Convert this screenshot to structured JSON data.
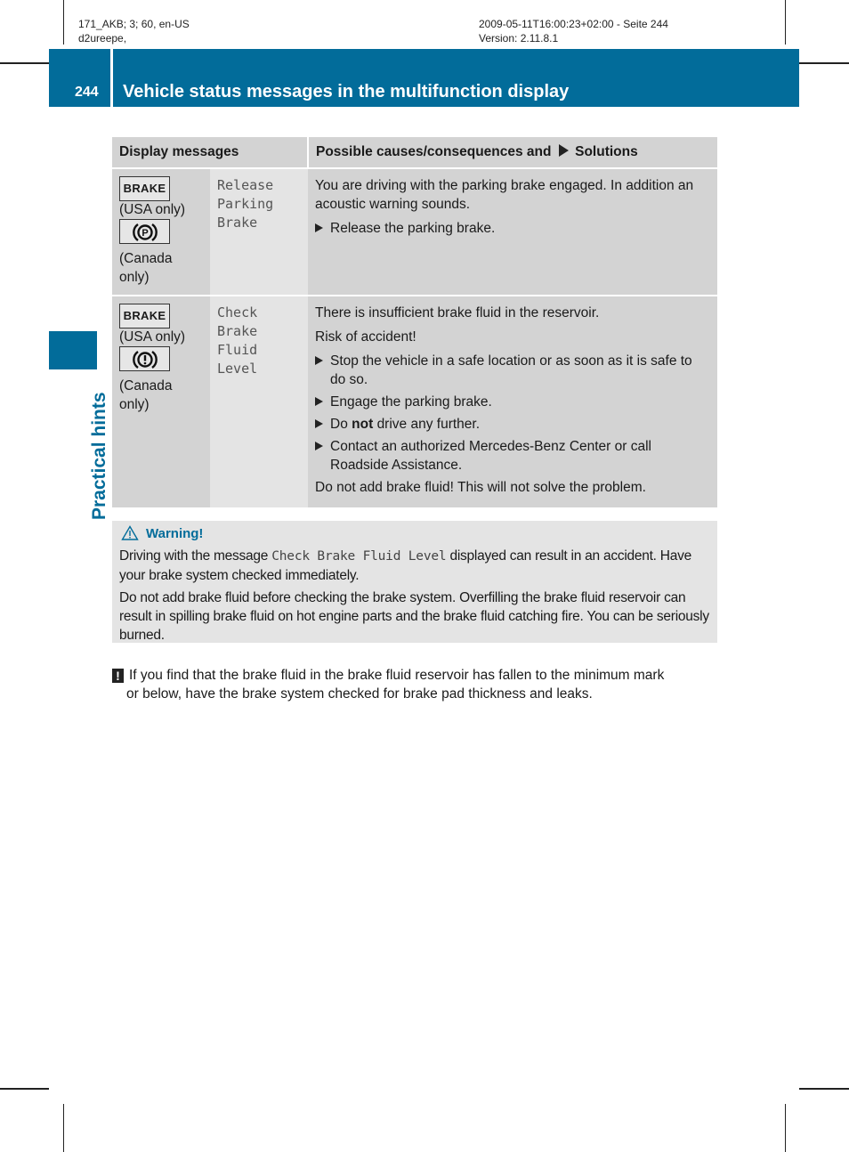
{
  "print_meta": {
    "left_line1": "171_AKB; 3; 60, en-US",
    "left_line2": "d2ureepe,",
    "right_line1": "2009-05-11T16:00:23+02:00 - Seite 244",
    "right_line2": "Version: 2.11.8.1"
  },
  "header": {
    "page_number": "244",
    "title": "Vehicle status messages in the multifunction display",
    "accent_color": "#026c9a"
  },
  "side_tab": {
    "label": "Practical hints"
  },
  "table": {
    "headers": {
      "display": "Display messages",
      "causes": "Possible causes/consequences and",
      "solutions": "Solutions"
    },
    "rows": [
      {
        "icon_usa_text": "BRAKE",
        "icon_usa_label": "(USA only)",
        "icon_canada": "parking-brake-icon",
        "icon_canada_label_1": "(Canada",
        "icon_canada_label_2": "only)",
        "display_lines": [
          "Release",
          "Parking",
          "Brake"
        ],
        "text_1": "You are driving with the parking brake engaged. In addition an acoustic warning sounds.",
        "steps": [
          "Release the parking brake."
        ]
      },
      {
        "icon_usa_text": "BRAKE",
        "icon_usa_label": "(USA only)",
        "icon_canada": "brake-warning-icon",
        "icon_canada_label_1": "(Canada",
        "icon_canada_label_2": "only)",
        "display_lines": [
          "Check",
          "Brake",
          "Fluid",
          "Level"
        ],
        "text_1": "There is insufficient brake fluid in the reservoir.",
        "text_2": "Risk of accident!",
        "steps": [
          "Stop the vehicle in a safe location or as soon as it is safe to do so.",
          "Engage the parking brake."
        ],
        "step_bold_prefix": "Do",
        "step_bold_word": "not",
        "step_bold_suffix": "drive any further.",
        "step_last": "Contact an authorized Mercedes-Benz Center or call Roadside Assistance.",
        "text_end": "Do not add brake fluid! This will not solve the problem."
      }
    ]
  },
  "warning": {
    "title": "Warning!",
    "p1_before": "Driving with the message",
    "p1_mono": "Check Brake Fluid Level",
    "p1_after": "displayed can result in an accident. Have your brake system checked immediately.",
    "p2": "Do not add brake fluid before checking the brake system. Overfilling the brake fluid reservoir can result in spilling brake fluid on hot engine parts and the brake fluid catching fire. You can be seriously burned."
  },
  "note": {
    "symbol": "!",
    "line1": "If you find that the brake fluid in the brake fluid reservoir has fallen to the minimum mark",
    "line2": "or below, have the brake system checked for brake pad thickness and leaks."
  }
}
